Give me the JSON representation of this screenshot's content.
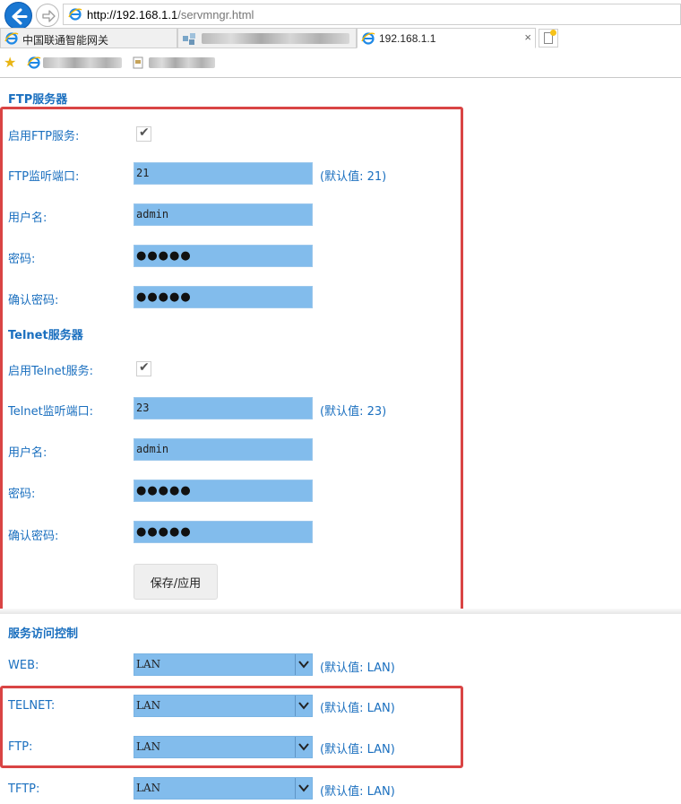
{
  "browser": {
    "address_host": "http://192.168.1.1",
    "address_path": "/servmngr.html",
    "tabs": [
      {
        "label": "中国联通智能网关"
      },
      {
        "label": ""
      },
      {
        "label": "192.168.1.1"
      }
    ],
    "tab_close": "×"
  },
  "ftp": {
    "title": "FTP服务器",
    "enable_label": "启用FTP服务:",
    "enabled": true,
    "port_label": "FTP监听端口:",
    "port": "21",
    "port_hint": "(默认值: 21)",
    "user_label": "用户名:",
    "user": "admin",
    "pwd_label": "密码:",
    "pwd": "●●●●●",
    "confirm_label": "确认密码:",
    "confirm": "●●●●●"
  },
  "telnet": {
    "title": "Telnet服务器",
    "enable_label": "启用Telnet服务:",
    "enabled": true,
    "port_label": "Telnet监听端口:",
    "port": "23",
    "port_hint": "(默认值: 23)",
    "user_label": "用户名:",
    "user": "admin",
    "pwd_label": "密码:",
    "pwd": "●●●●●",
    "confirm_label": "确认密码:",
    "confirm": "●●●●●"
  },
  "save_button": "保存/应用",
  "access": {
    "title": "服务访问控制",
    "rows": [
      {
        "label": "WEB:",
        "value": "LAN",
        "hint": "(默认值: LAN)"
      },
      {
        "label": "TELNET:",
        "value": "LAN",
        "hint": "(默认值: LAN)"
      },
      {
        "label": "FTP:",
        "value": "LAN",
        "hint": "(默认值: LAN)"
      },
      {
        "label": "TFTP:",
        "value": "LAN",
        "hint": "(默认值: LAN)"
      }
    ]
  },
  "colors": {
    "label": "#1a6fbf",
    "field_bg": "#82bcec",
    "highlight": "#d94444"
  }
}
